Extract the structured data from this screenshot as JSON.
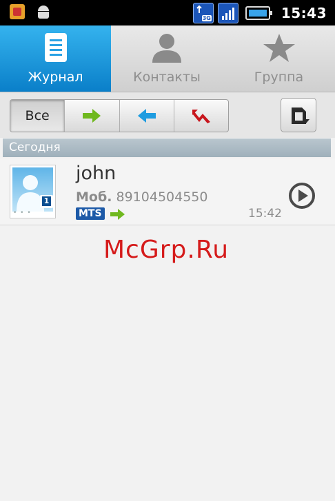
{
  "status_bar": {
    "time": "15:43",
    "network": "3G"
  },
  "tabs": [
    {
      "label": "Журнал",
      "icon": "log-icon",
      "active": true
    },
    {
      "label": "Контакты",
      "icon": "contacts-icon",
      "active": false
    },
    {
      "label": "Группа",
      "icon": "star-icon",
      "active": false
    }
  ],
  "filters": {
    "all_label": "Все",
    "selected": "all"
  },
  "section": {
    "title": "Сегодня"
  },
  "log": [
    {
      "name": "john",
      "number_type": "Моб.",
      "number": "89104504550",
      "carrier": "MTS",
      "direction": "outgoing",
      "time": "15:42"
    }
  ],
  "watermark": "McGrp.Ru",
  "colors": {
    "tab_active": "#0a7fc9",
    "outgoing": "#6fb81e",
    "incoming": "#1e9ce0",
    "missed": "#c8161d",
    "watermark": "#d51b1b"
  }
}
